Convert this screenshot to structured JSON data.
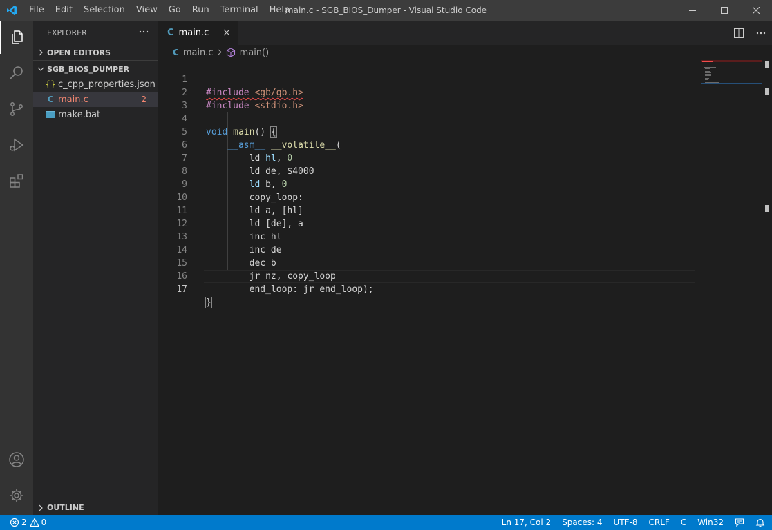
{
  "window": {
    "title": "main.c - SGB_BIOS_Dumper - Visual Studio Code",
    "menu": [
      "File",
      "Edit",
      "Selection",
      "View",
      "Go",
      "Run",
      "Terminal",
      "Help"
    ]
  },
  "sidebar": {
    "header": "EXPLORER",
    "open_editors": "OPEN EDITORS",
    "folder": "SGB_BIOS_DUMPER",
    "files": [
      {
        "name": "c_cpp_properties.json",
        "icon": "{}"
      },
      {
        "name": "main.c",
        "icon": "C",
        "badge": "2"
      },
      {
        "name": "make.bat",
        "icon": "bat-file-icon"
      }
    ],
    "outline": "OUTLINE"
  },
  "tab": {
    "icon": "C",
    "label": "main.c"
  },
  "breadcrumb": {
    "icon": "C",
    "file": "main.c",
    "symbol": "main()"
  },
  "editor": {
    "lines": [
      {
        "n": "1",
        "text": "#include <gb/gb.h>"
      },
      {
        "n": "2",
        "text": "#include <stdio.h>"
      },
      {
        "n": "3",
        "text": ""
      },
      {
        "n": "4",
        "text": "void main() {"
      },
      {
        "n": "5",
        "text": "    __asm__ __volatile__("
      },
      {
        "n": "6",
        "text": "        ld hl, 0"
      },
      {
        "n": "7",
        "text": "        ld de, $4000"
      },
      {
        "n": "8",
        "text": "        ld b, 0"
      },
      {
        "n": "9",
        "text": "        copy_loop:"
      },
      {
        "n": "10",
        "text": "        ld a, [hl]"
      },
      {
        "n": "11",
        "text": "        ld [de], a"
      },
      {
        "n": "12",
        "text": "        inc hl"
      },
      {
        "n": "13",
        "text": "        inc de"
      },
      {
        "n": "14",
        "text": "        dec b"
      },
      {
        "n": "15",
        "text": "        jr nz, copy_loop"
      },
      {
        "n": "16",
        "text": "        end_loop: jr end_loop);"
      },
      {
        "n": "17",
        "text": "}"
      }
    ]
  },
  "status": {
    "errors": "2",
    "warnings": "0",
    "position": "Ln 17, Col 2",
    "spaces": "Spaces: 4",
    "encoding": "UTF-8",
    "eol": "CRLF",
    "language": "C",
    "platform": "Win32"
  },
  "colors": {
    "accent": "#007acc",
    "activity_bar": "#333333",
    "sidebar": "#252526",
    "editor": "#1e1e1e",
    "titlebar": "#3c3c3c"
  }
}
